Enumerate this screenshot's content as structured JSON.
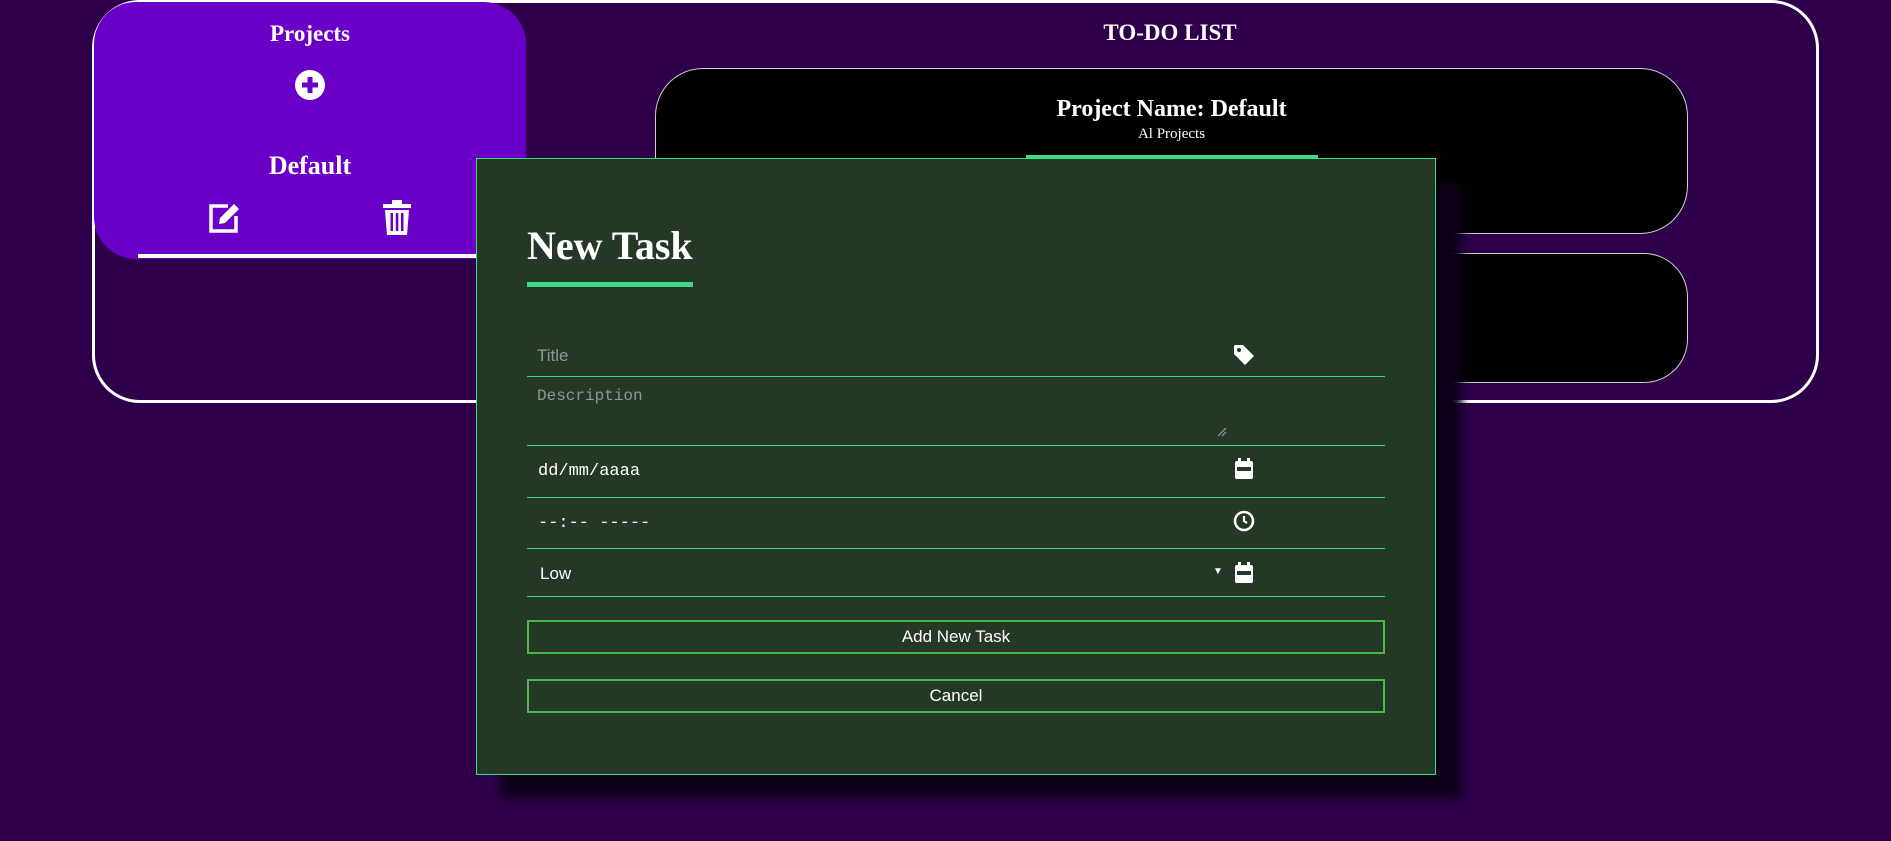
{
  "sidebar": {
    "title": "Projects",
    "add_icon": "plus-circle-icon",
    "project": {
      "name": "Default",
      "edit_icon": "edit-icon",
      "delete_icon": "trash-icon"
    }
  },
  "main": {
    "title": "TO-DO LIST",
    "project_card": {
      "name": "Project Name: Default",
      "subtitle": "Al Projects"
    }
  },
  "modal": {
    "title": "New Task",
    "title_placeholder": "Title",
    "title_icon": "tag-icon",
    "description_placeholder": "Description",
    "date_value": "dd/mm/aaaa",
    "date_icon": "calendar-icon",
    "time_value": "--:-- -----",
    "time_icon": "clock-icon",
    "priority_value": "Low",
    "priority_icon": "calendar-icon",
    "add_button": "Add New Task",
    "cancel_button": "Cancel"
  },
  "colors": {
    "background": "#2e004a",
    "sidebar": "#6a00c8",
    "modal": "#253826",
    "accent": "#3ddc84",
    "button_border": "#4cb848"
  }
}
